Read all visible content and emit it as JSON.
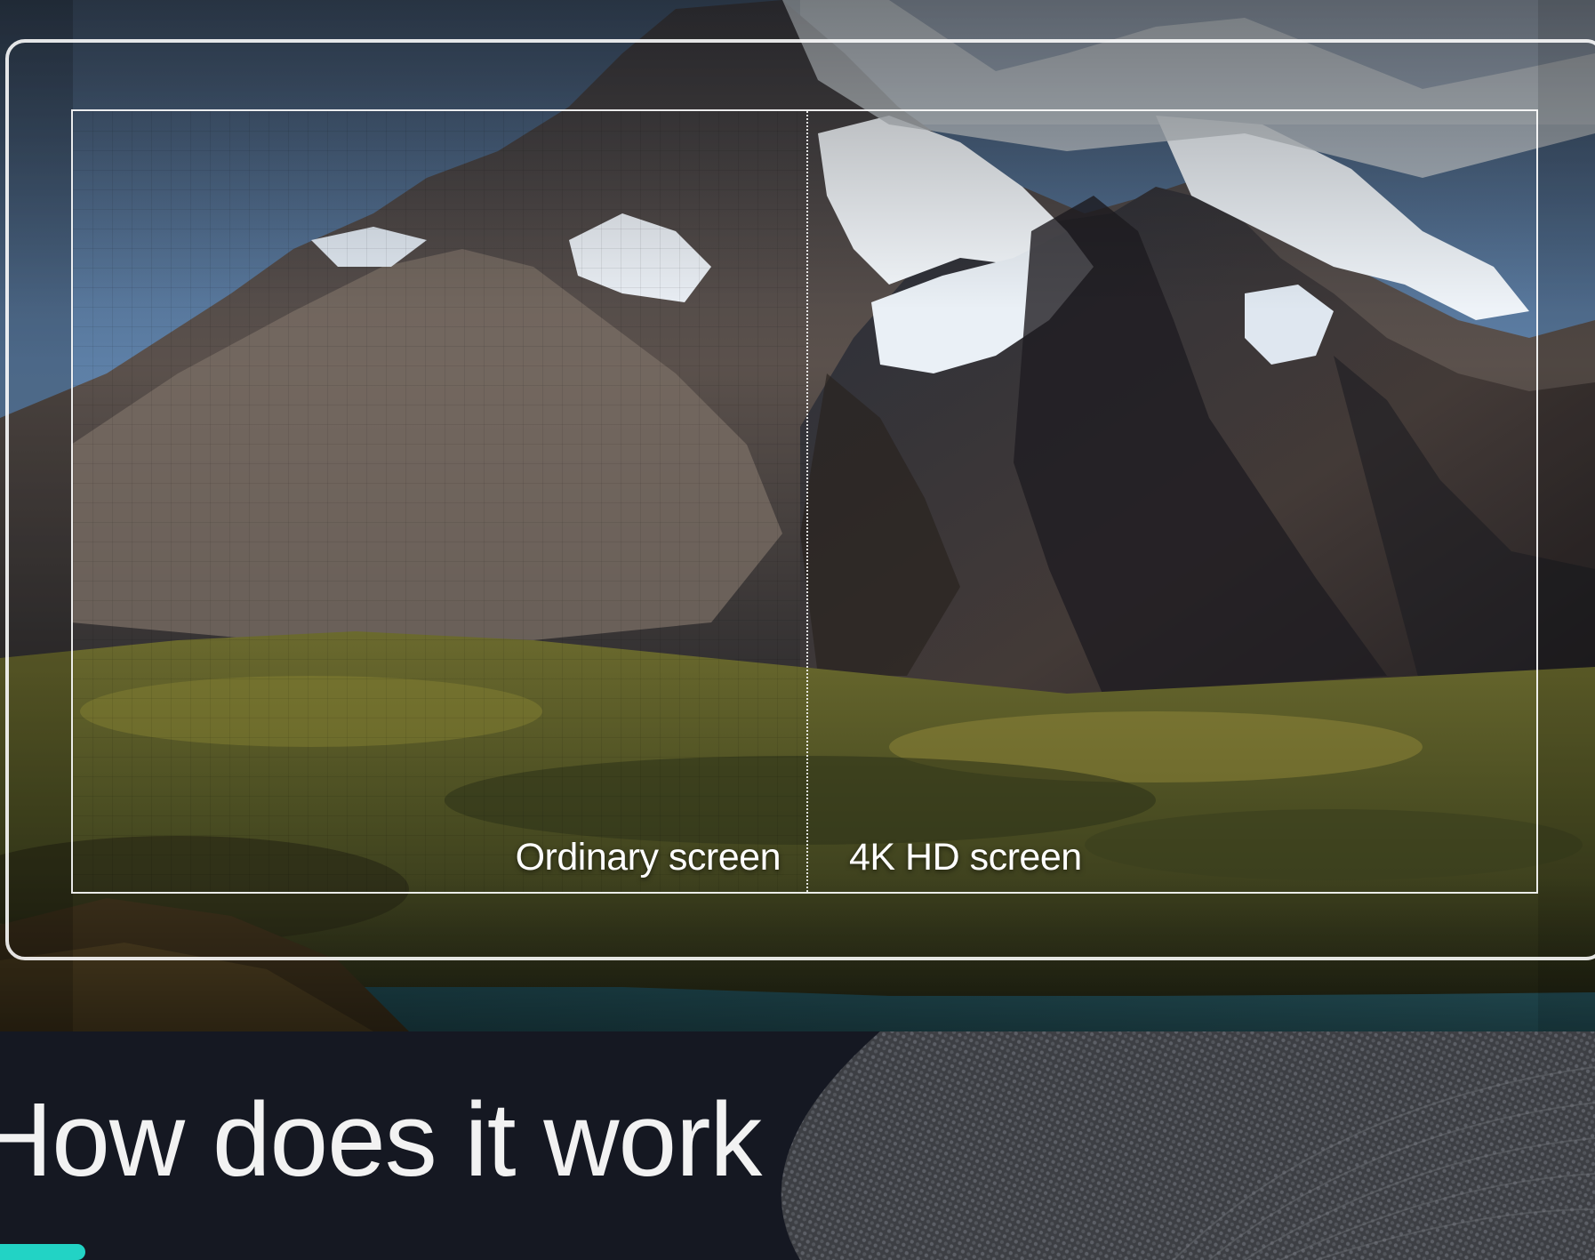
{
  "comparison": {
    "left_label": "Ordinary screen",
    "right_label": "4K HD screen"
  },
  "section": {
    "title": "How does it work"
  },
  "colors": {
    "accent": "#22d3c5",
    "background": "#151822"
  }
}
